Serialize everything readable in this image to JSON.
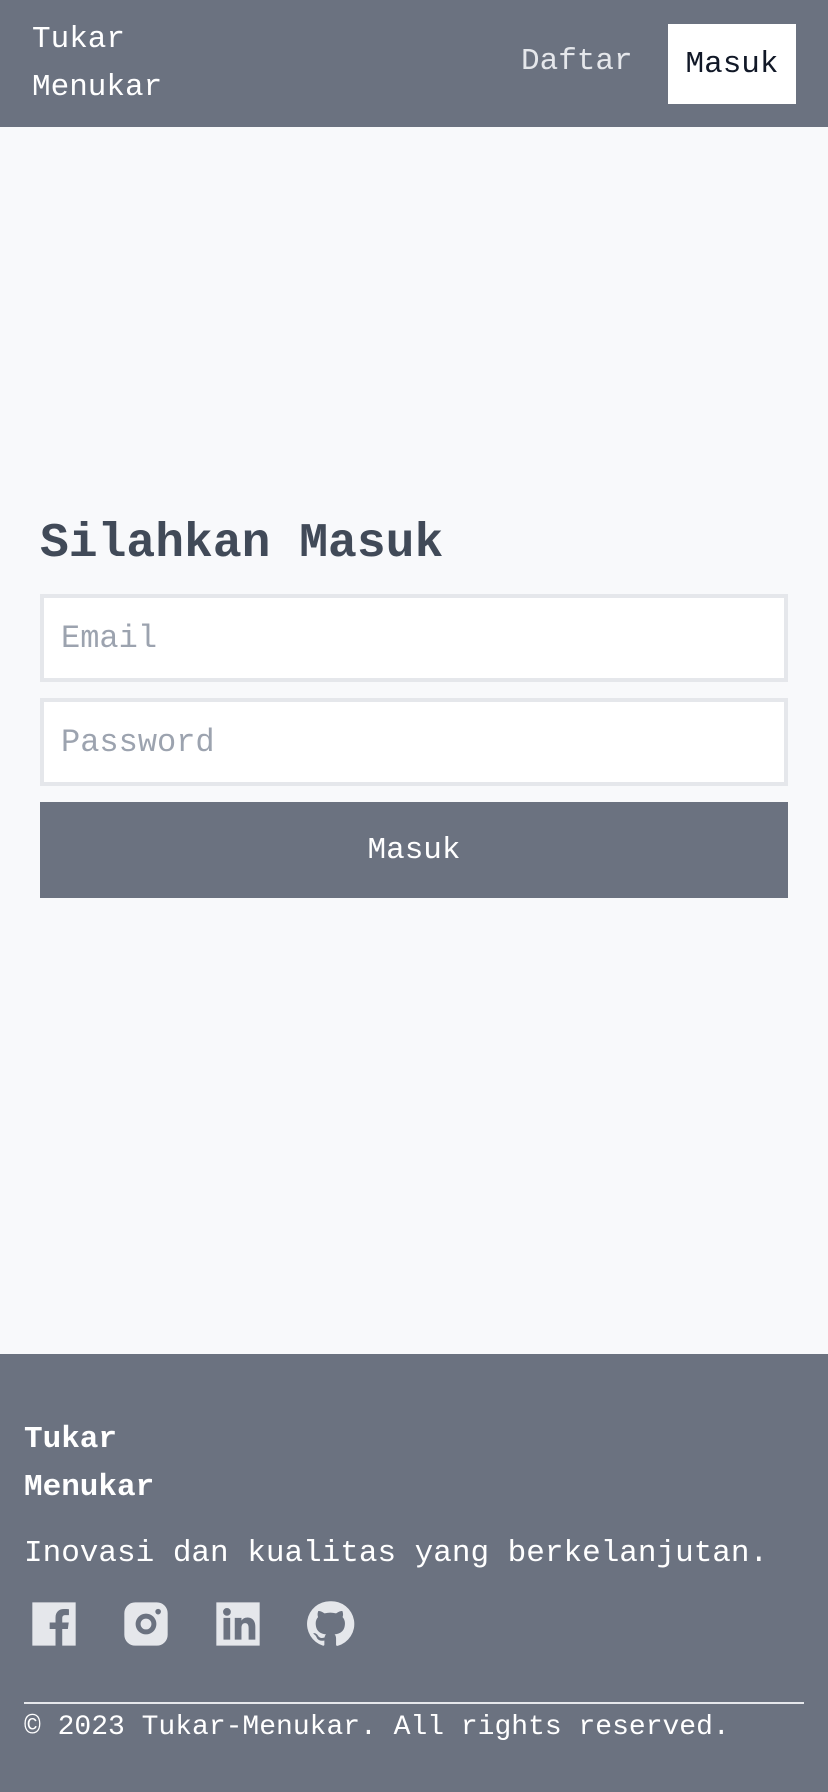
{
  "navbar": {
    "brand": "Tukar Menukar",
    "links": {
      "register": "Daftar",
      "login": "Masuk"
    }
  },
  "login": {
    "title": "Silahkan Masuk",
    "email_placeholder": "Email",
    "password_placeholder": "Password",
    "submit_label": "Masuk"
  },
  "footer": {
    "brand": "Tukar Menukar",
    "tagline": "Inovasi dan kualitas yang berkelanjutan.",
    "social_icons": [
      "facebook-icon",
      "instagram-icon",
      "linkedin-icon",
      "github-icon"
    ],
    "copyright": "© 2023 Tukar-Menukar. All rights reserved."
  },
  "colors": {
    "bar": "#6b7280",
    "page_background": "#f8f9fb",
    "title": "#414a58",
    "icon": "#e5e7eb"
  }
}
